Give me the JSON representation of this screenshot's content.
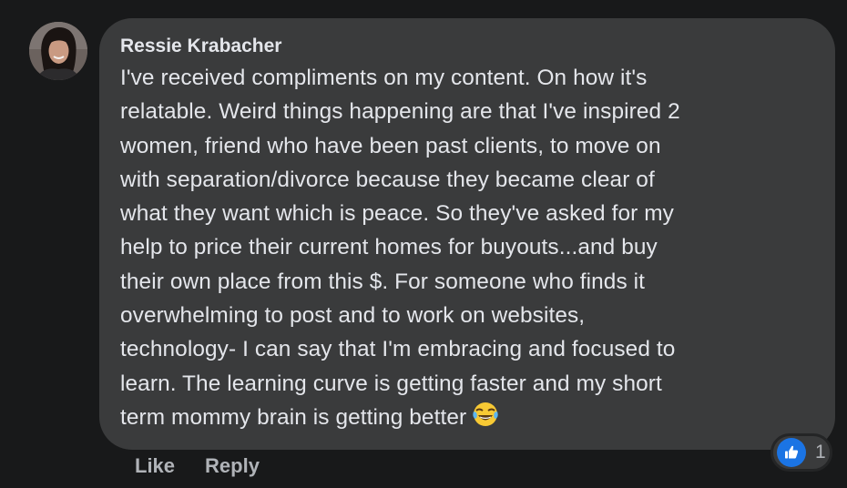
{
  "comment": {
    "author": "Ressie Krabacher",
    "lines": [
      "I've received compliments on my content. On how it's",
      "relatable. Weird things happening are that I've inspired 2",
      "women, friend who have been past clients, to move on",
      "with separation/divorce because they became clear of",
      "what they want which is peace. So they've asked for my",
      "help to price their current homes for buyouts...and buy",
      "their own place from this $. For someone who finds it",
      "overwhelming to post and to work on websites,",
      "technology- I can say that I'm embracing and focused to",
      "learn. The learning curve is getting faster and my short",
      "term mommy brain is getting better"
    ],
    "emoji": "tears-of-joy-emoji"
  },
  "actions": {
    "like_label": "Like",
    "reply_label": "Reply"
  },
  "reactions": {
    "icon": "thumbs-up-icon",
    "count": "1"
  },
  "colors": {
    "background": "#18191a",
    "bubble": "#3a3b3c",
    "text": "#e4e6eb",
    "secondary_text": "#b0b3b8",
    "like_blue": "#1b74e4"
  }
}
